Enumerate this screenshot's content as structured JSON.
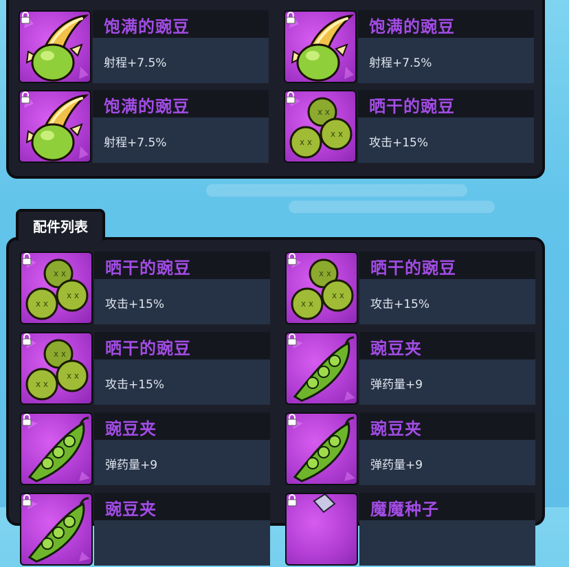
{
  "colors": {
    "name_purple": "#a24de4",
    "panel_bg": "#1c1f29",
    "icon_bg": "#b43fd6"
  },
  "equipped": [
    {
      "name": "饱满的豌豆",
      "desc": "射程+7.5%",
      "icon": "plump-pea-icon"
    },
    {
      "name": "饱满的豌豆",
      "desc": "射程+7.5%",
      "icon": "plump-pea-icon"
    },
    {
      "name": "饱满的豌豆",
      "desc": "射程+7.5%",
      "icon": "plump-pea-icon"
    },
    {
      "name": "晒干的豌豆",
      "desc": "攻击+15%",
      "icon": "dried-peas-icon"
    }
  ],
  "parts_list": {
    "title": "配件列表",
    "items": [
      {
        "name": "晒干的豌豆",
        "desc": "攻击+15%",
        "icon": "dried-peas-icon"
      },
      {
        "name": "晒干的豌豆",
        "desc": "攻击+15%",
        "icon": "dried-peas-icon"
      },
      {
        "name": "晒干的豌豆",
        "desc": "攻击+15%",
        "icon": "dried-peas-icon"
      },
      {
        "name": "豌豆夹",
        "desc": "弹药量+9",
        "icon": "pea-pod-icon"
      },
      {
        "name": "豌豆夹",
        "desc": "弹药量+9",
        "icon": "pea-pod-icon"
      },
      {
        "name": "豌豆夹",
        "desc": "弹药量+9",
        "icon": "pea-pod-icon"
      },
      {
        "name": "豌豆夹",
        "desc": "",
        "icon": "pea-pod-icon"
      },
      {
        "name": "魔魔种子",
        "desc": "",
        "icon": "magic-seed-icon"
      }
    ]
  }
}
